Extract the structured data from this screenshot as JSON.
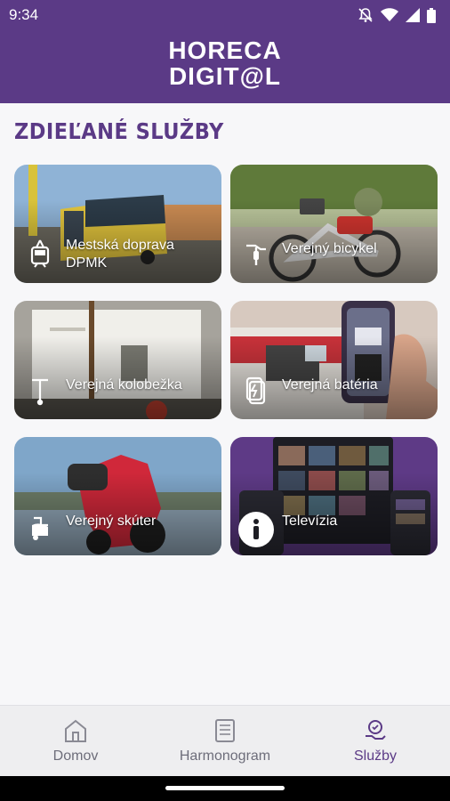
{
  "status_bar": {
    "time": "9:34"
  },
  "app": {
    "logo_line1": "HORECA",
    "logo_line2": "DIGIT@L"
  },
  "section": {
    "title": "ZDIEĽANÉ SLUŽBY"
  },
  "cards": [
    {
      "label": "Mestská doprava DPMK",
      "icon": "bus-icon"
    },
    {
      "label": "Verejný bicykel",
      "icon": "bicycle-icon"
    },
    {
      "label": "Verejná kolobežka",
      "icon": "scooter-icon"
    },
    {
      "label": "Verejná batéria",
      "icon": "battery-icon"
    },
    {
      "label": "Verejný skúter",
      "icon": "moped-icon"
    },
    {
      "label": "Televízia",
      "icon": "info-icon"
    }
  ],
  "bottom_nav": [
    {
      "label": "Domov",
      "icon": "home-icon",
      "active": false
    },
    {
      "label": "Harmonogram",
      "icon": "document-icon",
      "active": false
    },
    {
      "label": "Služby",
      "icon": "services-icon",
      "active": true
    }
  ],
  "colors": {
    "primary": "#5b3a86",
    "background": "#f7f7f9",
    "nav_inactive": "#6d6d7a"
  }
}
